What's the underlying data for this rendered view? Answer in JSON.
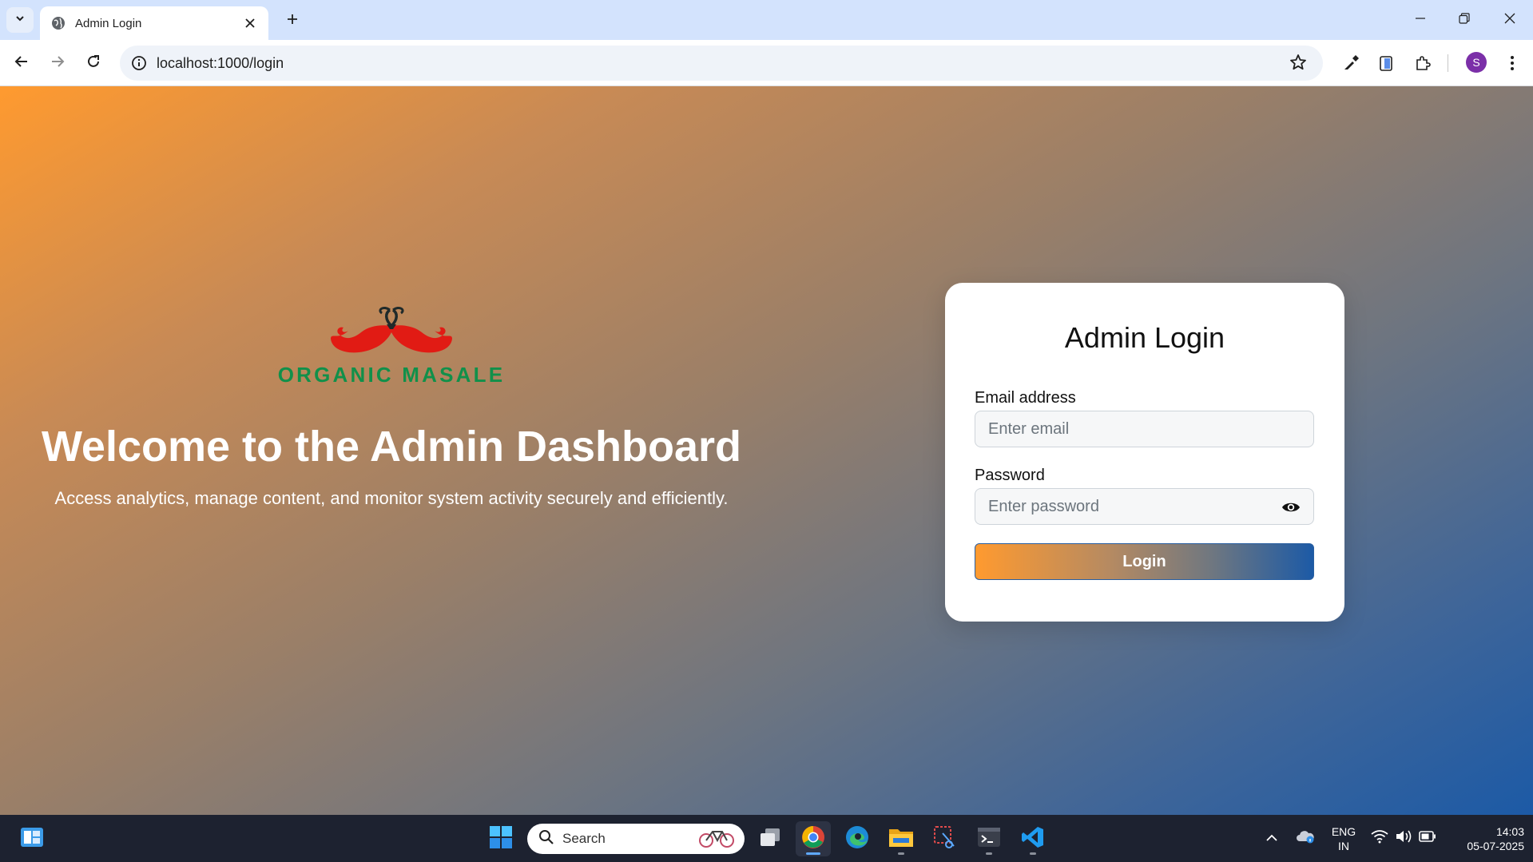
{
  "browser": {
    "tab_title": "Admin Login",
    "url": "localhost:1000/login",
    "profile_initial": "S"
  },
  "page": {
    "brand": "ORGANIC MASALE",
    "welcome_title": "Welcome to the Admin Dashboard",
    "welcome_subtitle": "Access analytics, manage content, and monitor system activity securely and efficiently.",
    "login_card": {
      "title": "Admin Login",
      "email_label": "Email address",
      "email_placeholder": "Enter email",
      "password_label": "Password",
      "password_placeholder": "Enter password",
      "submit_label": "Login"
    }
  },
  "taskbar": {
    "search_placeholder": "Search",
    "language": "ENG",
    "region": "IN",
    "time": "14:03",
    "date": "05-07-2025"
  },
  "colors": {
    "brand_green": "#11904a",
    "chili_red": "#e11b14",
    "gradient_start": "#ff9a2f",
    "gradient_end": "#1c5aa6"
  }
}
